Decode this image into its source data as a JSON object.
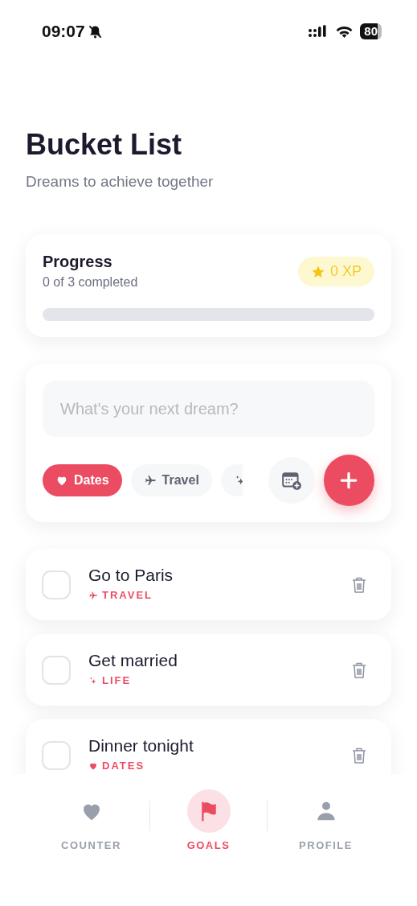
{
  "status_bar": {
    "time": "09:07",
    "battery": "80"
  },
  "header": {
    "title": "Bucket List",
    "subtitle": "Dreams to achieve together"
  },
  "progress": {
    "title": "Progress",
    "summary": "0 of 3 completed",
    "xp": "0 XP",
    "level": 0
  },
  "composer": {
    "placeholder": "What's your next dream?",
    "categories": [
      {
        "kind": "dates",
        "label": "Dates",
        "selected": true
      },
      {
        "kind": "travel",
        "label": "Travel",
        "selected": false
      },
      {
        "kind": "life",
        "selected": false
      }
    ]
  },
  "goals": [
    {
      "title": "Go to Paris",
      "kind": "travel",
      "category": "TRAVEL",
      "checked": false
    },
    {
      "title": "Get married",
      "kind": "life",
      "category": "LIFE",
      "checked": false
    },
    {
      "title": "Dinner tonight",
      "kind": "dates",
      "category": "DATES",
      "checked": false
    }
  ],
  "tab_bar": [
    {
      "kind": "heart",
      "label": "COUNTER",
      "selected": false
    },
    {
      "kind": "flag",
      "label": "GOALS",
      "selected": true
    },
    {
      "kind": "person",
      "label": "PROFILE",
      "selected": false
    }
  ]
}
